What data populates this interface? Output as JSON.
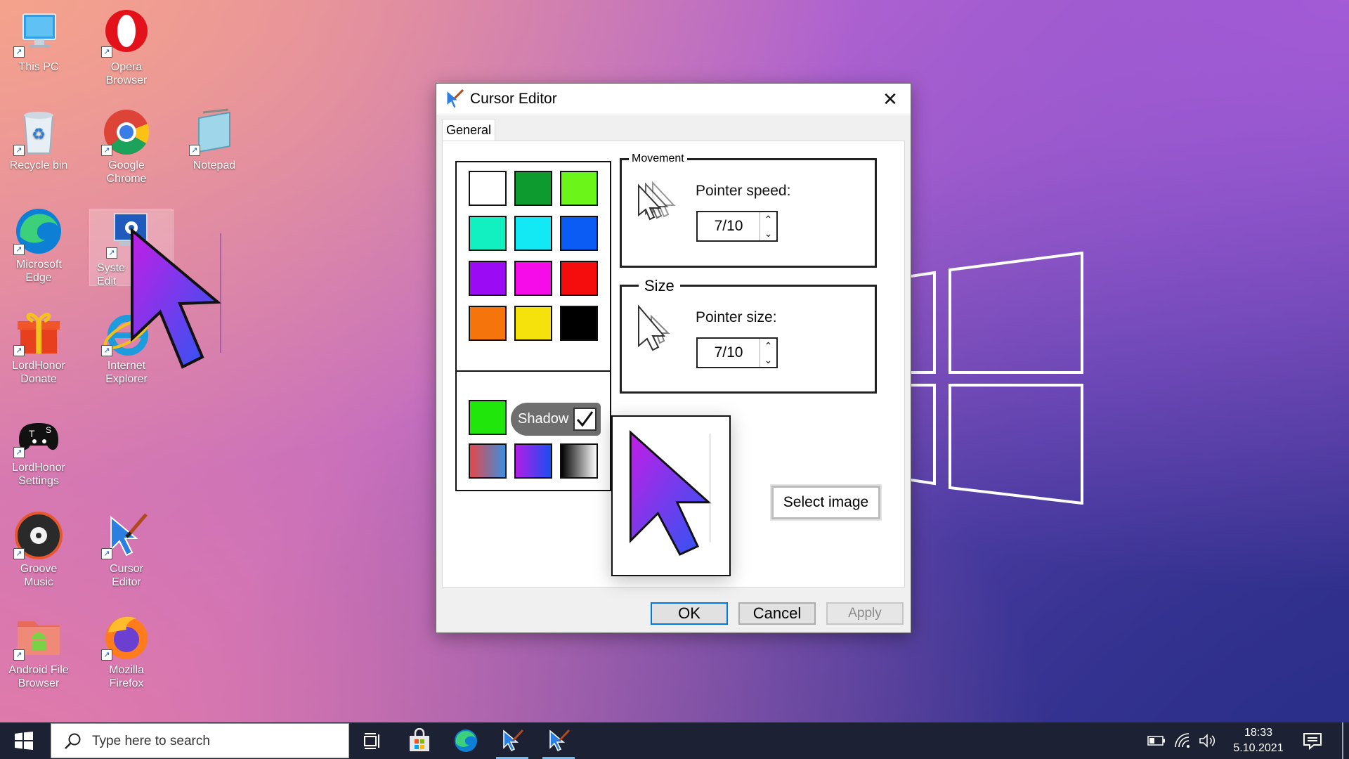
{
  "desktop": {
    "icons": [
      {
        "label": "This PC",
        "icon": "computer-icon"
      },
      {
        "label": "Opera Browser",
        "icon": "opera-icon"
      },
      {
        "label": "Recycle bin",
        "icon": "recycle-bin-icon"
      },
      {
        "label": "Google Chrome",
        "icon": "chrome-icon"
      },
      {
        "label": "Notepad",
        "icon": "notepad-icon"
      },
      {
        "label": "Microsoft Edge",
        "icon": "edge-icon"
      },
      {
        "label": "Syste Edit",
        "icon": "system-editor-icon"
      },
      {
        "label": "LordHonor Donate",
        "icon": "gift-icon"
      },
      {
        "label": "Internet Explorer",
        "icon": "ie-icon"
      },
      {
        "label": "LordHonor Settings",
        "icon": "gamepad-icon"
      },
      {
        "label": "Groove Music",
        "icon": "groove-icon"
      },
      {
        "label": "Cursor Editor",
        "icon": "cursor-editor-icon"
      },
      {
        "label": "Android File Browser",
        "icon": "android-folder-icon"
      },
      {
        "label": "Mozilla Firefox",
        "icon": "firefox-icon"
      }
    ]
  },
  "dialog": {
    "title": "Cursor Editor",
    "close_glyph": "✕",
    "tab": "General",
    "palette": {
      "colors": [
        "#ffffff",
        "#0d9a2f",
        "#6cf519",
        "#12f0c2",
        "#13e8f5",
        "#0b5cf4",
        "#9b0cf4",
        "#f50ce8",
        "#f50c0c",
        "#f5750c",
        "#f5e20c",
        "#000000"
      ],
      "single_color": "#21e60b",
      "gradients": [
        "red-blue",
        "purple-blue",
        "black-white"
      ],
      "shadow_label": "Shadow",
      "shadow_checked": true
    },
    "movement": {
      "legend": "Movement",
      "label": "Pointer speed:",
      "value": "7/10"
    },
    "size": {
      "legend": "Size",
      "label": "Pointer size:",
      "value": "7/10"
    },
    "select_image": "Select image",
    "buttons": {
      "ok": "OK",
      "cancel": "Cancel",
      "apply": "Apply"
    }
  },
  "taskbar": {
    "search_placeholder": "Type here to search",
    "apps": [
      "task-view-icon",
      "store-icon",
      "edge-icon",
      "cursor-editor-icon",
      "cursor-editor-icon"
    ],
    "clock_time": "18:33",
    "clock_date": "5.10.2021"
  }
}
